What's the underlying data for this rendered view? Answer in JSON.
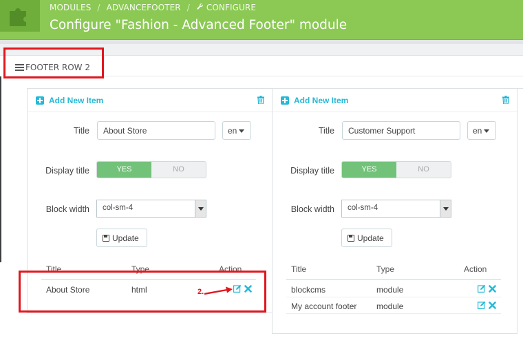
{
  "header": {
    "breadcrumb": [
      "MODULES",
      "ADVANCEFOOTER",
      "CONFIGURE"
    ],
    "breadcrumb_sep": "/",
    "title": "Configure \"Fashion - Advanced Footer\" module",
    "color": "#8bc954"
  },
  "section": {
    "title": "FOOTER ROW 2"
  },
  "columns": [
    {
      "add_label": "Add New Item",
      "title_label": "Title",
      "title_value": "About Store",
      "lang": "en",
      "display_title_label": "Display title",
      "yes_label": "YES",
      "no_label": "NO",
      "block_width_label": "Block width",
      "block_width_value": "col-sm-4",
      "update_label": "Update",
      "table_headers": [
        "Title",
        "Type",
        "Action"
      ],
      "rows": [
        {
          "title": "About Store",
          "type": "html"
        }
      ]
    },
    {
      "add_label": "Add New Item",
      "title_label": "Title",
      "title_value": "Customer Support",
      "lang": "en",
      "display_title_label": "Display title",
      "yes_label": "YES",
      "no_label": "NO",
      "block_width_label": "Block width",
      "block_width_value": "col-sm-4",
      "update_label": "Update",
      "table_headers": [
        "Title",
        "Type",
        "Action"
      ],
      "rows": [
        {
          "title": "blockcms",
          "type": "module"
        },
        {
          "title": "My account footer",
          "type": "module"
        }
      ]
    }
  ],
  "annotation": {
    "number": "2.",
    "color": "#e2151d"
  },
  "icons": [
    "puzzle-icon",
    "wrench-icon",
    "list-icon",
    "plus-icon",
    "trash-icon",
    "save-icon",
    "edit-icon",
    "delete-icon"
  ]
}
